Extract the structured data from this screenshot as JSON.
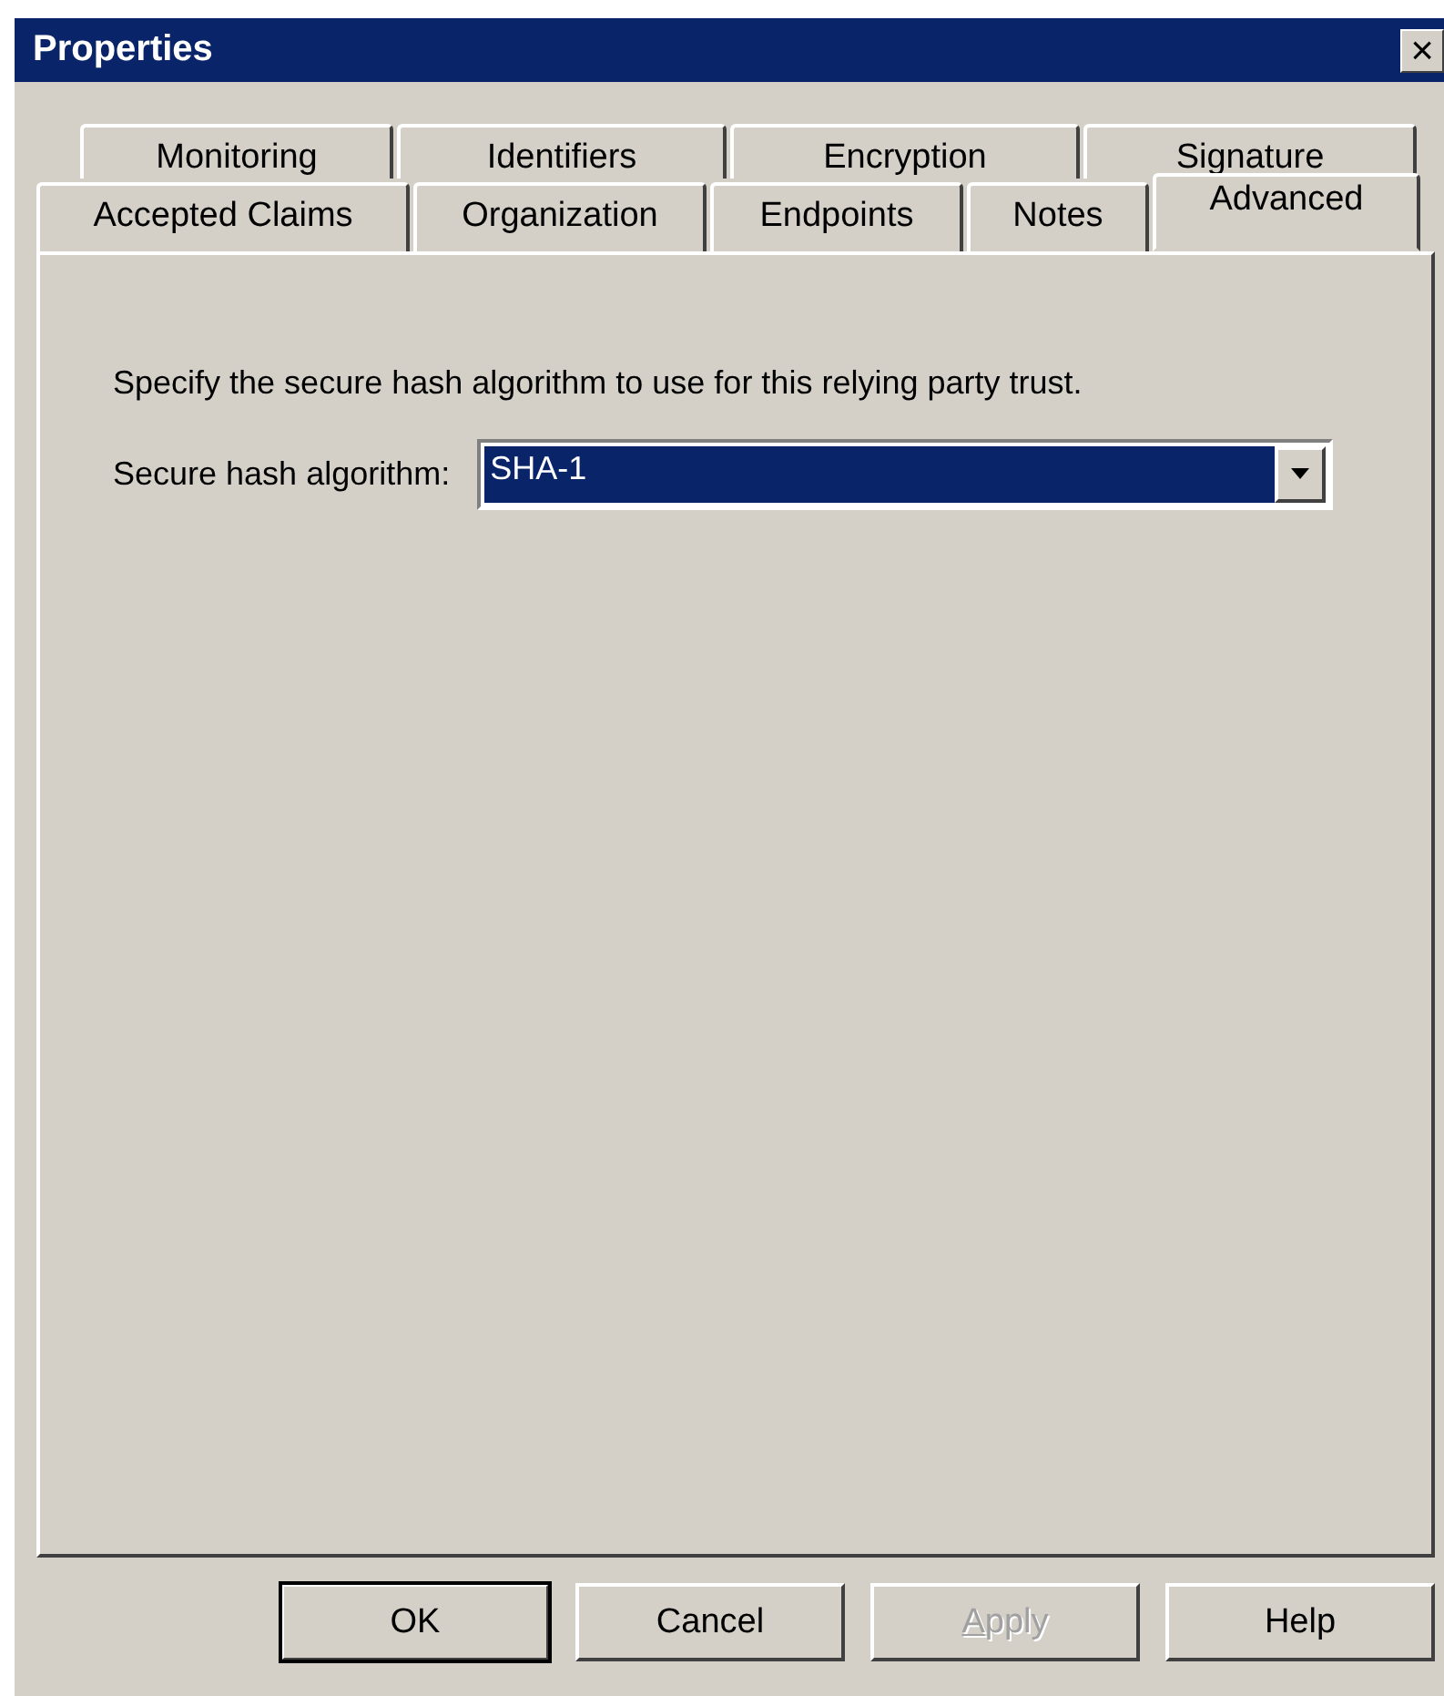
{
  "window": {
    "title": "Properties",
    "close": "×"
  },
  "tab_rows": [
    [
      {
        "label": "Monitoring",
        "selected": false
      },
      {
        "label": "Identifiers",
        "selected": false
      },
      {
        "label": "Encryption",
        "selected": false
      },
      {
        "label": "Signature",
        "selected": false
      }
    ],
    [
      {
        "label": "Accepted Claims",
        "selected": false
      },
      {
        "label": "Organization",
        "selected": false
      },
      {
        "label": "Endpoints",
        "selected": false
      },
      {
        "label": "Notes",
        "selected": false
      },
      {
        "label": "Advanced",
        "selected": true
      }
    ]
  ],
  "description": "Specify the secure hash algorithm to use for this relying party trust.",
  "hash_field": {
    "label": "Secure hash algorithm:",
    "value": "SHA-1",
    "focused": true
  },
  "buttons": [
    {
      "label": "OK",
      "default": true,
      "disabled": false,
      "underline_first": false
    },
    {
      "label": "Cancel",
      "default": false,
      "disabled": false,
      "underline_first": false
    },
    {
      "label": "Apply",
      "default": false,
      "disabled": true,
      "underline_first": true
    },
    {
      "label": "Help",
      "default": false,
      "disabled": false,
      "underline_first": false
    }
  ]
}
